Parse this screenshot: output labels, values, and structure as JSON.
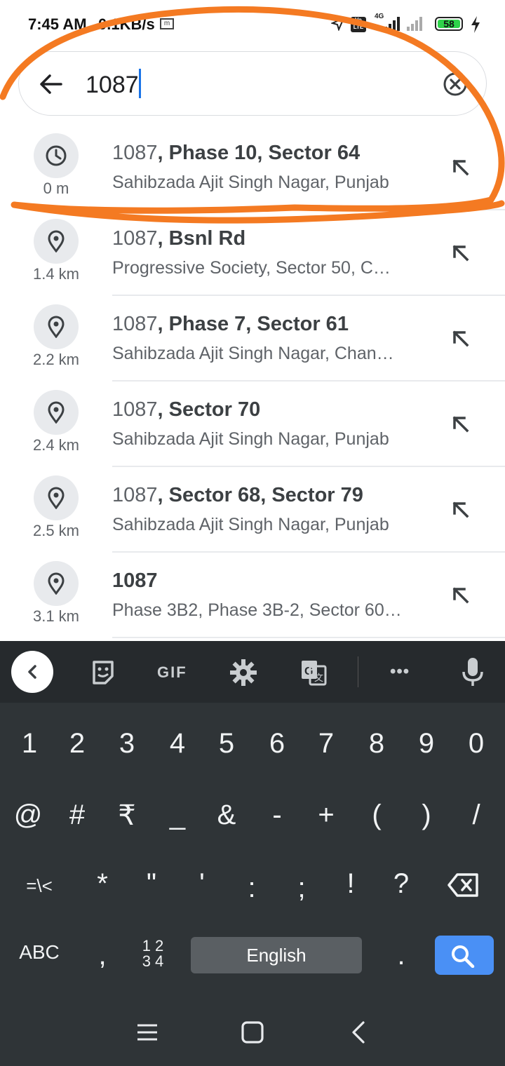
{
  "status_bar": {
    "time": "7:45 AM",
    "speed": "0.1KB/s",
    "network": "4G",
    "volte": "Vo LTE",
    "battery": "58"
  },
  "search": {
    "query": "1087"
  },
  "results": [
    {
      "icon": "history-icon",
      "distance": "0 m",
      "highlight": "1087",
      "rest": ", Phase 10, Sector 64",
      "subtitle": "Sahibzada Ajit Singh Nagar, Punjab"
    },
    {
      "icon": "place-pin-icon",
      "distance": "1.4 km",
      "highlight": "1087",
      "rest": ", Bsnl Rd",
      "subtitle": "Progressive Society, Sector 50, C…"
    },
    {
      "icon": "place-pin-icon",
      "distance": "2.2 km",
      "highlight": "1087",
      "rest": ", Phase 7, Sector 61",
      "subtitle": "Sahibzada Ajit Singh Nagar, Chan…"
    },
    {
      "icon": "place-pin-icon",
      "distance": "2.4 km",
      "highlight": "1087",
      "rest": ", Sector 70",
      "subtitle": "Sahibzada Ajit Singh Nagar, Punjab"
    },
    {
      "icon": "place-pin-icon",
      "distance": "2.5 km",
      "highlight": "1087",
      "rest": ", Sector 68, Sector 79",
      "subtitle": "Sahibzada Ajit Singh Nagar, Punjab"
    },
    {
      "icon": "place-pin-icon",
      "distance": "3.1 km",
      "highlight": "",
      "rest": "1087",
      "subtitle": "Phase 3B2, Phase 3B-2, Sector 60…"
    }
  ],
  "keyboard": {
    "toolbar": {
      "gif_label": "GIF",
      "more_label": "•••"
    },
    "row1": [
      "1",
      "2",
      "3",
      "4",
      "5",
      "6",
      "7",
      "8",
      "9",
      "0"
    ],
    "row2": [
      "@",
      "#",
      "₹",
      "_",
      "&",
      "-",
      "+",
      "(",
      ")",
      "/"
    ],
    "row3": [
      "=\\<",
      "*",
      "\"",
      "'",
      ":",
      ";",
      "!",
      "?"
    ],
    "abc_label": "ABC",
    "comma": ",",
    "numpad_label_top": "1 2",
    "numpad_label_bottom": "3 4",
    "space_label": "English",
    "period": "."
  },
  "colors": {
    "annotation": "#f47a22",
    "accent": "#1a73e8",
    "keyboard_bg": "#2f3437",
    "go_key": "#4a90f5"
  }
}
